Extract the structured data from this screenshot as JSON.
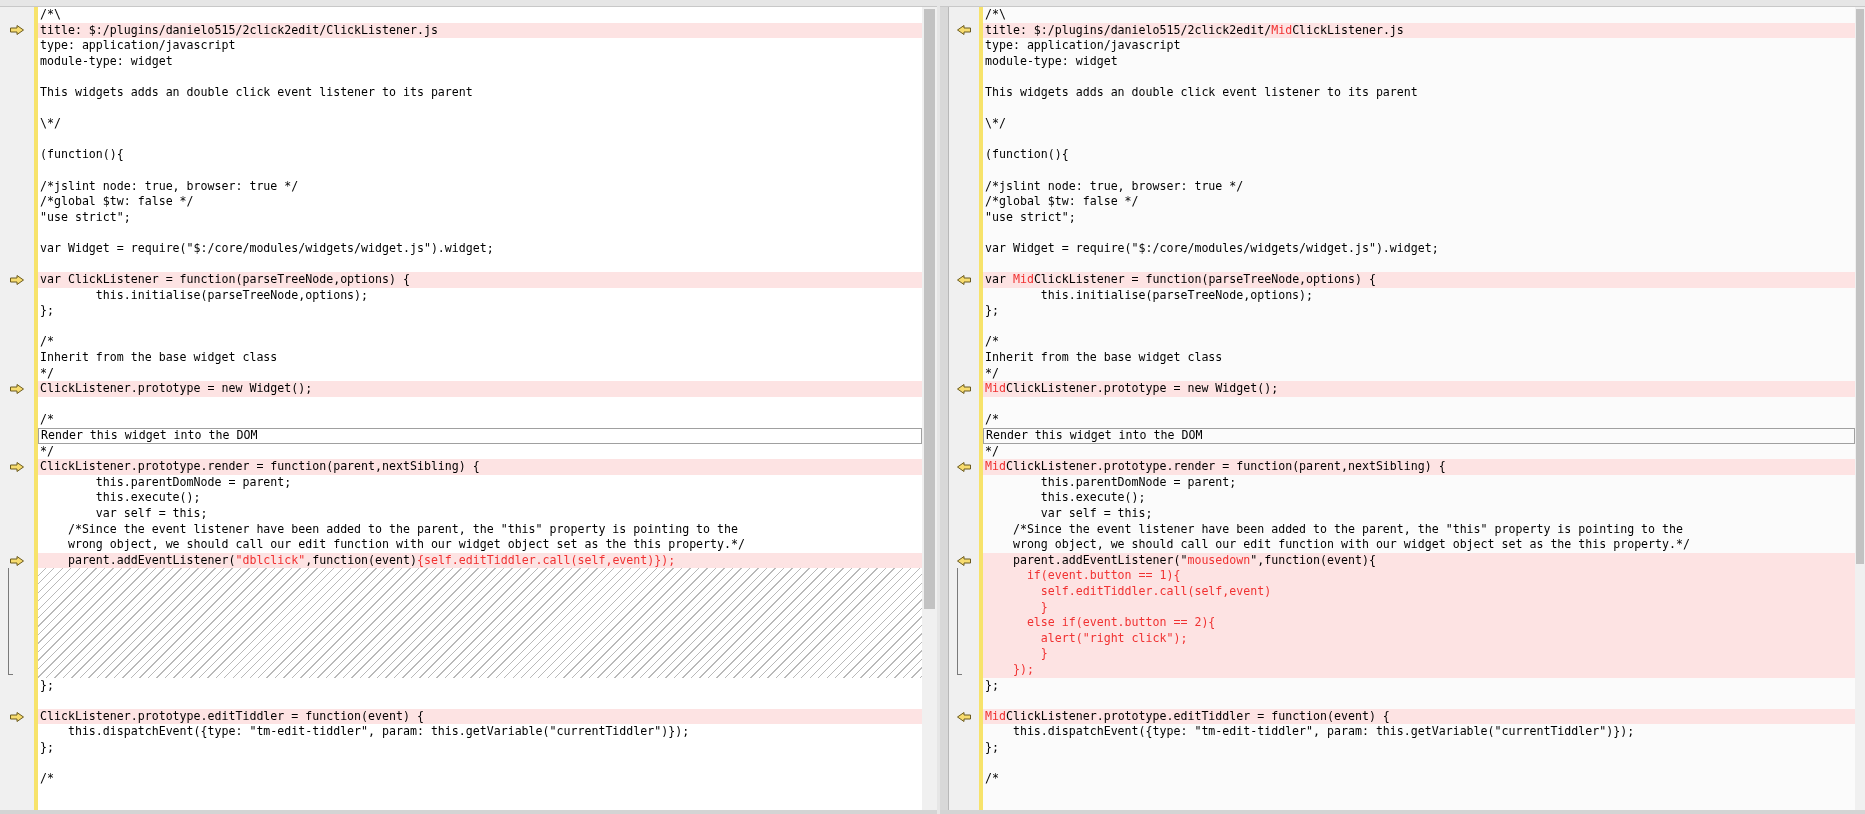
{
  "panes": [
    {
      "kind": "left",
      "lines": [
        {
          "kind": "same",
          "text": "/*\\"
        },
        {
          "kind": "diff",
          "segments": [
            {
              "text": "title: $:/plugins/danielo515/2click2edit/ClickListener.js",
              "changed": false
            }
          ]
        },
        {
          "kind": "same",
          "text": "type: application/javascript"
        },
        {
          "kind": "same",
          "text": "module-type: widget"
        },
        {
          "kind": "blank"
        },
        {
          "kind": "same",
          "text": "This widgets adds an double click event listener to its parent"
        },
        {
          "kind": "blank"
        },
        {
          "kind": "same",
          "text": "\\*/"
        },
        {
          "kind": "blank"
        },
        {
          "kind": "same",
          "text": "(function(){"
        },
        {
          "kind": "blank"
        },
        {
          "kind": "same",
          "text": "/*jslint node: true, browser: true */"
        },
        {
          "kind": "same",
          "text": "/*global $tw: false */"
        },
        {
          "kind": "same",
          "text": "\"use strict\";"
        },
        {
          "kind": "blank"
        },
        {
          "kind": "same",
          "text": "var Widget = require(\"$:/core/modules/widgets/widget.js\").widget;"
        },
        {
          "kind": "blank"
        },
        {
          "kind": "diff",
          "segments": [
            {
              "text": "var ClickListener = function(parseTreeNode,options) {",
              "changed": false
            }
          ]
        },
        {
          "kind": "same",
          "text": "        this.initialise(parseTreeNode,options);"
        },
        {
          "kind": "same",
          "text": "};"
        },
        {
          "kind": "blank"
        },
        {
          "kind": "same",
          "text": "/*"
        },
        {
          "kind": "same",
          "text": "Inherit from the base widget class"
        },
        {
          "kind": "same",
          "text": "*/"
        },
        {
          "kind": "diff",
          "segments": [
            {
              "text": "ClickListener.prototype = new Widget();",
              "changed": false
            }
          ]
        },
        {
          "kind": "blank"
        },
        {
          "kind": "same",
          "text": "/*"
        },
        {
          "kind": "current",
          "text": "Render this widget into the DOM"
        },
        {
          "kind": "same",
          "text": "*/"
        },
        {
          "kind": "diff",
          "segments": [
            {
              "text": "ClickListener.prototype.render = function(parent,nextSibling) {",
              "changed": false
            }
          ]
        },
        {
          "kind": "same",
          "text": "        this.parentDomNode = parent;"
        },
        {
          "kind": "same",
          "text": "        this.execute();"
        },
        {
          "kind": "same",
          "text": "        var self = this;"
        },
        {
          "kind": "same",
          "text": "    /*Since the event listener have been added to the parent, the \"this\" property is pointing to the"
        },
        {
          "kind": "same",
          "text": "    wrong object, we should call our edit function with our widget object set as the this property.*/"
        },
        {
          "kind": "diff",
          "segments": [
            {
              "text": "    parent.addEventListener(",
              "changed": false
            },
            {
              "text": "\"dblclick\"",
              "changed": true
            },
            {
              "text": ",function(event)",
              "changed": false
            },
            {
              "text": "{self.editTiddler.call(self,event)});",
              "changed": true
            }
          ]
        },
        {
          "kind": "gap"
        },
        {
          "kind": "gap"
        },
        {
          "kind": "gap"
        },
        {
          "kind": "gap"
        },
        {
          "kind": "gap"
        },
        {
          "kind": "gap"
        },
        {
          "kind": "gap"
        },
        {
          "kind": "same",
          "text": "};"
        },
        {
          "kind": "blank"
        },
        {
          "kind": "diff",
          "segments": [
            {
              "text": "ClickListener.prototype.editTiddler = function(event) {",
              "changed": false
            }
          ]
        },
        {
          "kind": "same",
          "text": "    this.dispatchEvent({type: \"tm-edit-tiddler\", param: this.getVariable(\"currentTiddler\")});"
        },
        {
          "kind": "same",
          "text": "};"
        },
        {
          "kind": "blank"
        },
        {
          "kind": "same",
          "text": "/*"
        }
      ]
    },
    {
      "kind": "right",
      "lines": [
        {
          "kind": "same",
          "text": "/*\\"
        },
        {
          "kind": "diff",
          "segments": [
            {
              "text": "title: $:/plugins/danielo515/2click2edit/",
              "changed": false
            },
            {
              "text": "Mid",
              "changed": true
            },
            {
              "text": "ClickListener.js",
              "changed": false
            }
          ]
        },
        {
          "kind": "same",
          "text": "type: application/javascript"
        },
        {
          "kind": "same",
          "text": "module-type: widget"
        },
        {
          "kind": "blank"
        },
        {
          "kind": "same",
          "text": "This widgets adds an double click event listener to its parent"
        },
        {
          "kind": "blank"
        },
        {
          "kind": "same",
          "text": "\\*/"
        },
        {
          "kind": "blank"
        },
        {
          "kind": "same",
          "text": "(function(){"
        },
        {
          "kind": "blank"
        },
        {
          "kind": "same",
          "text": "/*jslint node: true, browser: true */"
        },
        {
          "kind": "same",
          "text": "/*global $tw: false */"
        },
        {
          "kind": "same",
          "text": "\"use strict\";"
        },
        {
          "kind": "blank"
        },
        {
          "kind": "same",
          "text": "var Widget = require(\"$:/core/modules/widgets/widget.js\").widget;"
        },
        {
          "kind": "blank"
        },
        {
          "kind": "diff",
          "segments": [
            {
              "text": "var ",
              "changed": false
            },
            {
              "text": "Mid",
              "changed": true
            },
            {
              "text": "ClickListener = function(parseTreeNode,options) {",
              "changed": false
            }
          ]
        },
        {
          "kind": "same",
          "text": "        this.initialise(parseTreeNode,options);"
        },
        {
          "kind": "same",
          "text": "};"
        },
        {
          "kind": "blank"
        },
        {
          "kind": "same",
          "text": "/*"
        },
        {
          "kind": "same",
          "text": "Inherit from the base widget class"
        },
        {
          "kind": "same",
          "text": "*/"
        },
        {
          "kind": "diff",
          "segments": [
            {
              "text": "Mid",
              "changed": true
            },
            {
              "text": "ClickListener.prototype = new Widget();",
              "changed": false
            }
          ]
        },
        {
          "kind": "blank"
        },
        {
          "kind": "same",
          "text": "/*"
        },
        {
          "kind": "current",
          "text": "Render this widget into the DOM"
        },
        {
          "kind": "same",
          "text": "*/"
        },
        {
          "kind": "diff",
          "segments": [
            {
              "text": "Mid",
              "changed": true
            },
            {
              "text": "ClickListener.prototype.render = function(parent,nextSibling) {",
              "changed": false
            }
          ]
        },
        {
          "kind": "same",
          "text": "        this.parentDomNode = parent;"
        },
        {
          "kind": "same",
          "text": "        this.execute();"
        },
        {
          "kind": "same",
          "text": "        var self = this;"
        },
        {
          "kind": "same",
          "text": "    /*Since the event listener have been added to the parent, the \"this\" property is pointing to the"
        },
        {
          "kind": "same",
          "text": "    wrong object, we should call our edit function with our widget object set as the this property.*/"
        },
        {
          "kind": "diff",
          "segments": [
            {
              "text": "    parent.addEventListener(\"",
              "changed": false
            },
            {
              "text": "mousedown",
              "changed": true
            },
            {
              "text": "\",function(event){",
              "changed": false
            }
          ]
        },
        {
          "kind": "diff",
          "segments": [
            {
              "text": "      if(event.button == 1){",
              "changed": true
            }
          ]
        },
        {
          "kind": "diff",
          "segments": [
            {
              "text": "        self.editTiddler.call(self,event)",
              "changed": true
            }
          ]
        },
        {
          "kind": "diff",
          "segments": [
            {
              "text": "        }",
              "changed": true
            }
          ]
        },
        {
          "kind": "diff",
          "segments": [
            {
              "text": "      else if(event.button == 2){",
              "changed": true
            }
          ]
        },
        {
          "kind": "diff",
          "segments": [
            {
              "text": "        alert(\"right click\");",
              "changed": true
            }
          ]
        },
        {
          "kind": "diff",
          "segments": [
            {
              "text": "        }",
              "changed": true
            }
          ]
        },
        {
          "kind": "diff",
          "segments": [
            {
              "text": "    });",
              "changed": true
            }
          ]
        },
        {
          "kind": "same",
          "text": "};"
        },
        {
          "kind": "blank"
        },
        {
          "kind": "diff",
          "segments": [
            {
              "text": "Mid",
              "changed": true
            },
            {
              "text": "ClickListener.prototype.editTiddler = function(event) {",
              "changed": false
            }
          ]
        },
        {
          "kind": "same",
          "text": "    this.dispatchEvent({type: \"tm-edit-tiddler\", param: this.getVariable(\"currentTiddler\")});"
        },
        {
          "kind": "same",
          "text": "};"
        },
        {
          "kind": "blank"
        },
        {
          "kind": "same",
          "text": "/*"
        }
      ]
    }
  ]
}
